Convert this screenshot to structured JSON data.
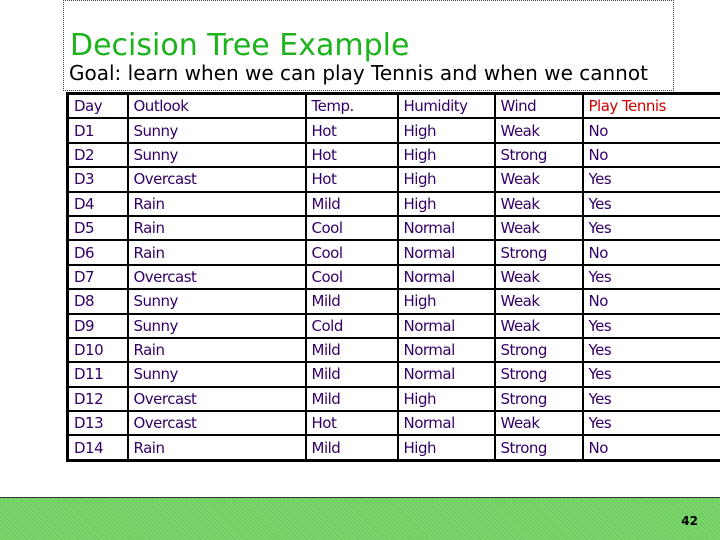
{
  "title": "Decision Tree Example",
  "subtitle": "Goal: learn when we can play Tennis and when we cannot",
  "table": {
    "headers": [
      "Day",
      "Outlook",
      "Temp.",
      "Humidity",
      "Wind",
      "Play Tennis"
    ],
    "rows": [
      [
        "D1",
        "Sunny",
        "Hot",
        "High",
        "Weak",
        "No"
      ],
      [
        "D2",
        "Sunny",
        "Hot",
        "High",
        "Strong",
        "No"
      ],
      [
        "D3",
        "Overcast",
        "Hot",
        "High",
        "Weak",
        "Yes"
      ],
      [
        "D4",
        "Rain",
        "Mild",
        "High",
        "Weak",
        "Yes"
      ],
      [
        "D5",
        "Rain",
        "Cool",
        "Normal",
        "Weak",
        "Yes"
      ],
      [
        "D6",
        "Rain",
        "Cool",
        "Normal",
        "Strong",
        "No"
      ],
      [
        "D7",
        "Overcast",
        "Cool",
        "Normal",
        "Weak",
        "Yes"
      ],
      [
        "D8",
        "Sunny",
        "Mild",
        "High",
        "Weak",
        "No"
      ],
      [
        "D9",
        "Sunny",
        "Cold",
        "Normal",
        "Weak",
        "Yes"
      ],
      [
        "D10",
        "Rain",
        "Mild",
        "Normal",
        "Strong",
        "Yes"
      ],
      [
        "D11",
        "Sunny",
        "Mild",
        "Normal",
        "Strong",
        "Yes"
      ],
      [
        "D12",
        "Overcast",
        "Mild",
        "High",
        "Strong",
        "Yes"
      ],
      [
        "D13",
        "Overcast",
        "Hot",
        "Normal",
        "Weak",
        "Yes"
      ],
      [
        "D14",
        "Rain",
        "Mild",
        "High",
        "Strong",
        "No"
      ]
    ]
  },
  "page_number": "42",
  "colors": {
    "title": "#1db31d",
    "target_header": "#cc0000",
    "cell_text": "#330066",
    "footer": "#6fcf5f"
  }
}
